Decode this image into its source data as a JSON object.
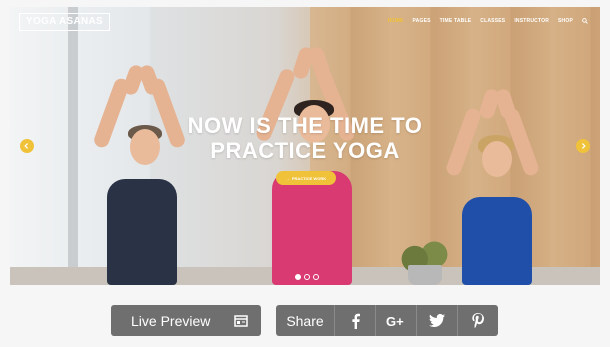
{
  "site": {
    "logo": "YOGA ASANAS",
    "nav": [
      "HOME",
      "PAGES",
      "TIME TABLE",
      "CLASSES",
      "INSTRUCTOR",
      "SHOP"
    ]
  },
  "hero": {
    "headline_line1": "NOW IS THE TIME TO",
    "headline_line2": "PRACTICE YOGA",
    "cta_label": "PRACTICE WORK",
    "slides_total": 3,
    "slide_active": 1
  },
  "actions": {
    "live_preview": "Live Preview",
    "share": "Share",
    "social": [
      "facebook-icon",
      "google-plus-icon",
      "twitter-icon",
      "pinterest-icon"
    ]
  },
  "colors": {
    "accent": "#f0c23a",
    "button": "#6f6f6f"
  }
}
